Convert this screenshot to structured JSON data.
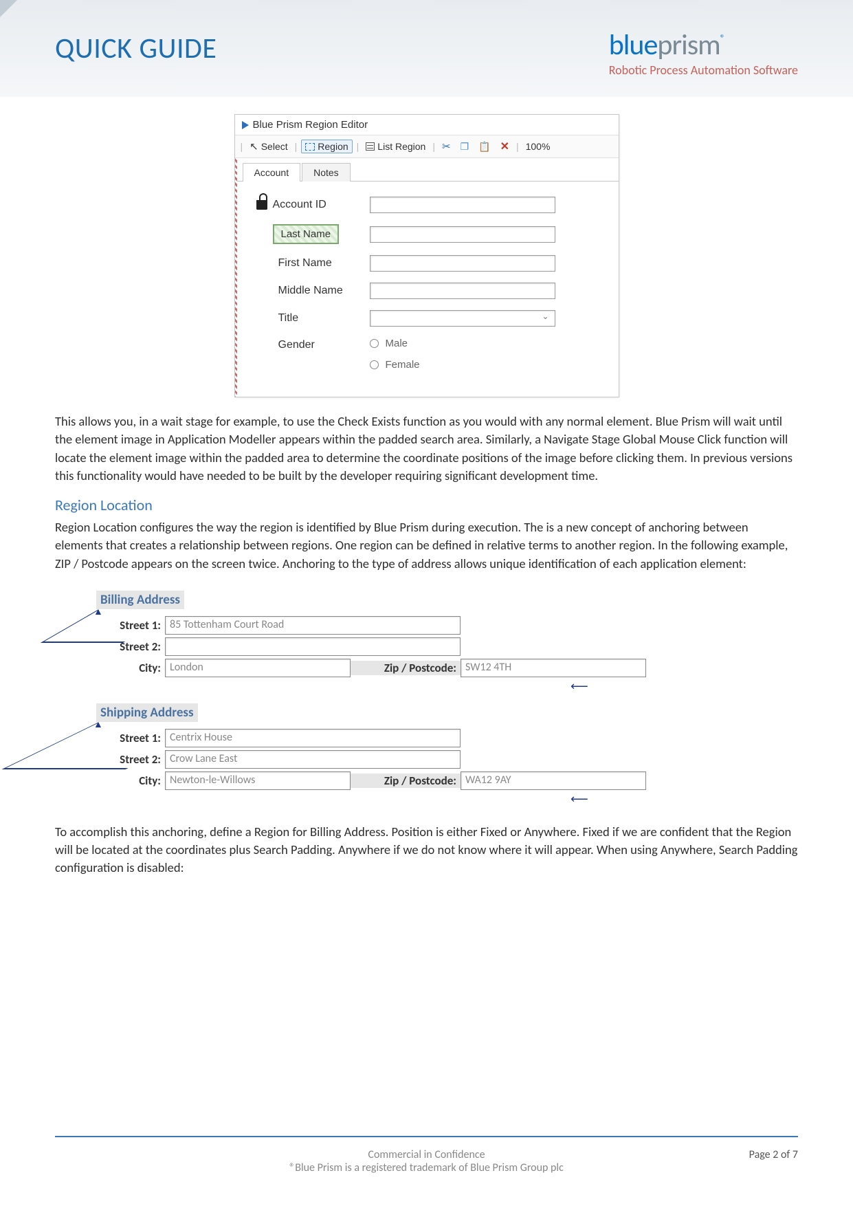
{
  "header": {
    "title": "QUICK GUIDE",
    "logo_blue": "blue",
    "logo_grey": "prism",
    "logo_sub": "Robotic Process Automation Software"
  },
  "editor": {
    "window_title": "Blue Prism Region Editor",
    "toolbar": {
      "select": "Select",
      "region": "Region",
      "list_region": "List Region",
      "zoom": "100%"
    },
    "tabs": {
      "account": "Account",
      "notes": "Notes"
    },
    "labels": {
      "account_id": "Account ID",
      "last_name": "Last Name",
      "first_name": "First Name",
      "middle_name": "Middle Name",
      "title": "Title",
      "gender": "Gender",
      "male": "Male",
      "female": "Female"
    }
  },
  "para1": "This allows you, in a wait stage for example, to use the Check Exists function as you would with any normal element. Blue Prism will wait until the element image in Application Modeller appears within the padded search area. Similarly, a Navigate Stage Global Mouse Click function will locate the element image within the padded area to determine the coordinate positions of the image before clicking them. In previous versions this functionality would have needed to be built by the developer requiring significant development time.",
  "section_title": "Region Location",
  "para2": "Region Location configures the way the region is identified by Blue Prism during execution. The is a new concept of anchoring between elements that creates a relationship between regions. One region can be defined in relative terms to another region. In the following example, ZIP / Postcode appears on the screen twice. Anchoring to the type of address allows unique identification of each application element:",
  "billing": {
    "title": "Billing Address",
    "street1_label": "Street 1:",
    "street1": "85 Tottenham Court Road",
    "street2_label": "Street 2:",
    "street2": "",
    "city_label": "City:",
    "city": "London",
    "zip_label": "Zip / Postcode:",
    "zip": "SW12 4TH"
  },
  "shipping": {
    "title": "Shipping Address",
    "street1_label": "Street 1:",
    "street1": "Centrix House",
    "street2_label": "Street 2:",
    "street2": "Crow Lane East",
    "city_label": "City:",
    "city": "Newton-le-Willows",
    "zip_label": "Zip / Postcode:",
    "zip": "WA12 9AY"
  },
  "para3": "To accomplish this anchoring, define a Region for Billing Address. Position is either Fixed or Anywhere. Fixed if we are confident that the Region will be located at the coordinates plus Search Padding. Anywhere if we do not know where it will appear. When using Anywhere, Search Padding configuration is disabled:",
  "footer": {
    "line1": "Commercial in Confidence",
    "line2": "®Blue Prism is a registered trademark of Blue Prism Group plc",
    "page": "Page 2 of 7"
  }
}
